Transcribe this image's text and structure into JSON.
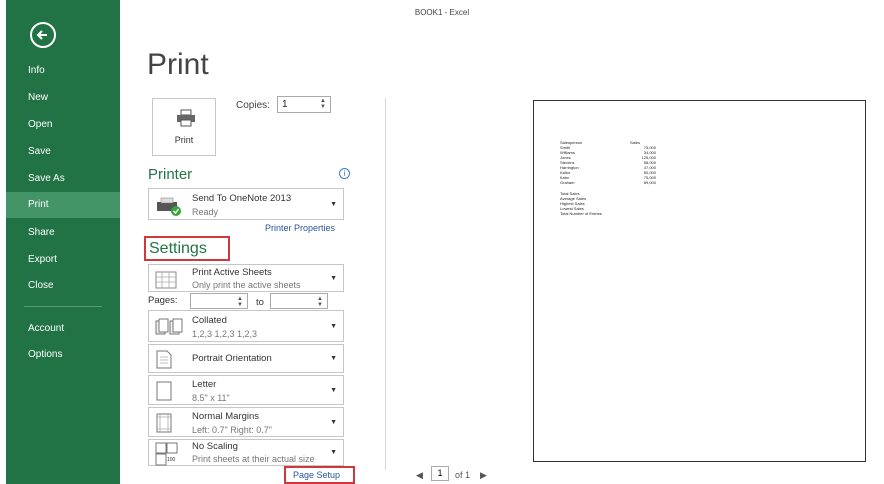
{
  "window": {
    "title": "BOOK1 - Excel"
  },
  "sidebar": {
    "items": [
      {
        "label": "Info"
      },
      {
        "label": "New"
      },
      {
        "label": "Open"
      },
      {
        "label": "Save"
      },
      {
        "label": "Save As"
      },
      {
        "label": "Print",
        "active": true
      },
      {
        "label": "Share"
      },
      {
        "label": "Export"
      },
      {
        "label": "Close"
      },
      {
        "label": "Account"
      },
      {
        "label": "Options"
      }
    ],
    "back_icon": "back-arrow-icon"
  },
  "page": {
    "title": "Print"
  },
  "print": {
    "button_label": "Print",
    "copies_label": "Copies:",
    "copies_value": "1"
  },
  "printer": {
    "section_title": "Printer",
    "name": "Send To OneNote 2013",
    "status": "Ready",
    "properties_link": "Printer Properties"
  },
  "settings": {
    "section_title": "Settings",
    "what": {
      "main": "Print Active Sheets",
      "sub": "Only print the active sheets"
    },
    "pages_label": "Pages:",
    "pages_to": "to",
    "pages_from_value": "",
    "pages_to_value": "",
    "collation": {
      "main": "Collated",
      "sub": "1,2,3   1,2,3   1,2,3"
    },
    "orientation": {
      "main": "Portrait Orientation"
    },
    "paper": {
      "main": "Letter",
      "sub": "8.5\" x 11\""
    },
    "margins": {
      "main": "Normal Margins",
      "sub": "Left: 0.7\"   Right: 0.7\""
    },
    "scaling": {
      "main": "No Scaling",
      "sub": "Print sheets at their actual size",
      "icon_text": "100"
    },
    "page_setup_link": "Page Setup"
  },
  "preview": {
    "page_num": "1",
    "page_total": "of 1",
    "sheet": {
      "header": [
        "Salesperson",
        "Sales"
      ],
      "rows": [
        [
          "Smith",
          "75,000"
        ],
        [
          "Williams",
          "34,000"
        ],
        [
          "Jones",
          "125,000"
        ],
        [
          "Stevens",
          "58,000"
        ],
        [
          "Harrington",
          "47,000"
        ],
        [
          "Kallor",
          "50,000"
        ],
        [
          "Kahn",
          "75,000"
        ],
        [
          "Graham",
          "89,000"
        ]
      ],
      "summary": [
        "Total Sales",
        "Average Sales",
        "Highest Sales",
        "Lowest Sales",
        "Total Number of Entries"
      ]
    }
  },
  "colors": {
    "accent": "#217346",
    "active_nav": "#439467",
    "highlight_box": "#d0393b",
    "link": "#2a5699"
  }
}
